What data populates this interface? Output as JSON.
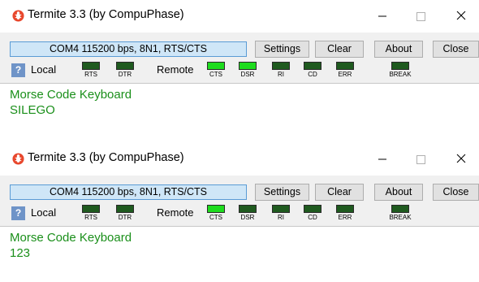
{
  "windows": [
    {
      "title": "Termite 3.3 (by CompuPhase)",
      "port_status": "COM4 115200 bps, 8N1, RTS/CTS",
      "buttons": {
        "settings": "Settings",
        "clear": "Clear",
        "about": "About",
        "close": "Close"
      },
      "status": {
        "help": "?",
        "local_label": "Local",
        "remote_label": "Remote",
        "leds": {
          "rts": {
            "label": "RTS",
            "on": false
          },
          "dtr": {
            "label": "DTR",
            "on": false
          },
          "cts": {
            "label": "CTS",
            "on": true
          },
          "dsr": {
            "label": "DSR",
            "on": true
          },
          "ri": {
            "label": "RI",
            "on": false
          },
          "cd": {
            "label": "CD",
            "on": false
          },
          "err": {
            "label": "ERR",
            "on": false
          },
          "break": {
            "label": "BREAK",
            "on": false
          }
        }
      },
      "terminal": [
        "Morse Code Keyboard",
        "SILEGO"
      ]
    },
    {
      "title": "Termite 3.3 (by CompuPhase)",
      "port_status": "COM4 115200 bps, 8N1, RTS/CTS",
      "buttons": {
        "settings": "Settings",
        "clear": "Clear",
        "about": "About",
        "close": "Close"
      },
      "status": {
        "help": "?",
        "local_label": "Local",
        "remote_label": "Remote",
        "leds": {
          "rts": {
            "label": "RTS",
            "on": false
          },
          "dtr": {
            "label": "DTR",
            "on": false
          },
          "cts": {
            "label": "CTS",
            "on": true
          },
          "dsr": {
            "label": "DSR",
            "on": false
          },
          "ri": {
            "label": "RI",
            "on": false
          },
          "cd": {
            "label": "CD",
            "on": false
          },
          "err": {
            "label": "ERR",
            "on": false
          },
          "break": {
            "label": "BREAK",
            "on": false
          }
        }
      },
      "terminal": [
        "Morse Code Keyboard",
        "123"
      ]
    }
  ],
  "colors": {
    "terminal_text": "#1a8f1a",
    "led_on": "#1edc1e",
    "led_off": "#1f5a1f",
    "port_box_bg": "#cfe6f7",
    "port_box_border": "#5a9bd5",
    "toolbar_bg": "#f0f0f0",
    "help_bg": "#6f94c8"
  },
  "icons": {
    "app": "termite-icon",
    "minimize": "minimize-icon",
    "maximize": "maximize-icon",
    "close": "close-icon"
  }
}
